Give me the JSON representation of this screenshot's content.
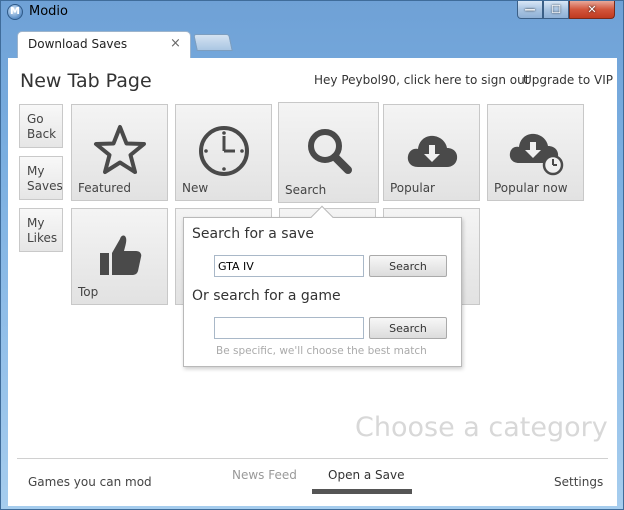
{
  "window": {
    "app_title": "Modio",
    "logo_letter": "M",
    "controls": {
      "minimize": "—",
      "maximize": "☐",
      "close": "✕"
    }
  },
  "tabs": {
    "active_label": "Download Saves",
    "close_glyph": "×"
  },
  "header": {
    "page_title": "New Tab Page",
    "signout_text": "Hey Peybol90, click here to sign out",
    "upgrade_text": "Upgrade to VIP"
  },
  "side_nav": [
    {
      "line1": "Go",
      "line2": "Back"
    },
    {
      "line1": "My",
      "line2": "Saves"
    },
    {
      "line1": "My",
      "line2": "Likes"
    }
  ],
  "tiles": [
    {
      "label": "Featured",
      "icon": "star-icon"
    },
    {
      "label": "New",
      "icon": "clock-icon"
    },
    {
      "label": "Search",
      "icon": "magnifier-icon"
    },
    {
      "label": "Popular",
      "icon": "cloud-download-icon"
    },
    {
      "label": "Popular now",
      "icon": "cloud-download-clock-icon"
    },
    {
      "label": "Top",
      "icon": "thumbs-up-icon"
    }
  ],
  "search_popover": {
    "save_heading": "Search for a save",
    "save_value": "GTA IV",
    "save_button": "Search",
    "game_heading": "Or search for a game",
    "game_value": "",
    "game_button": "Search",
    "hint": "Be specific, we'll choose the best match"
  },
  "main": {
    "placeholder_text": "Choose a category"
  },
  "footer": {
    "games_link": "Games you can mod",
    "news_tab": "News Feed",
    "open_tab": "Open a Save",
    "settings_link": "Settings"
  }
}
